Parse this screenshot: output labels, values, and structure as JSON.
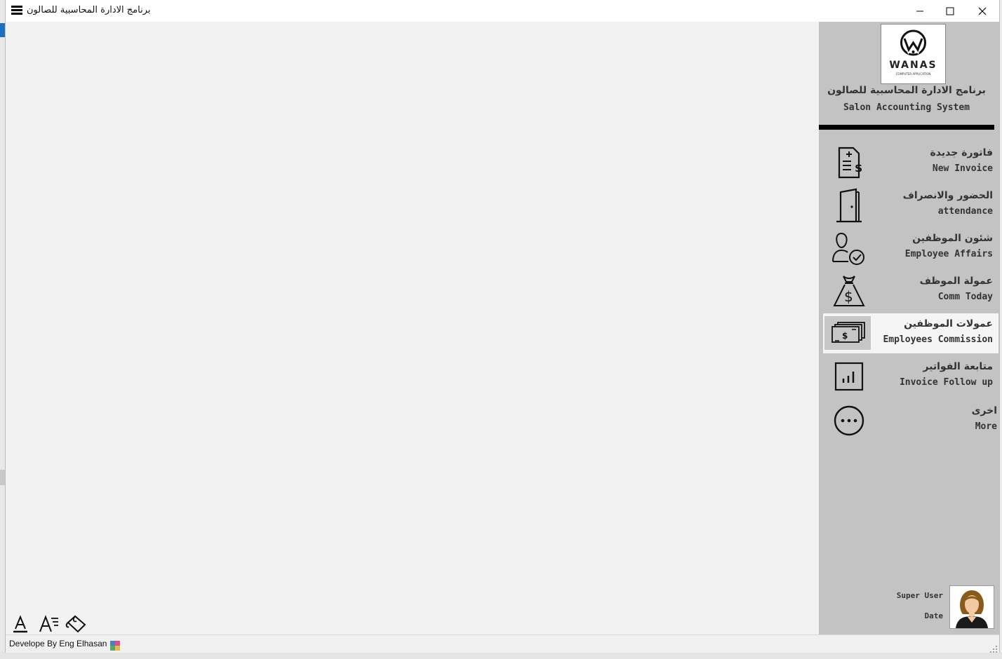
{
  "window": {
    "title": "برنامج الادارة المحاسبية للصالون"
  },
  "sidebar": {
    "logo": {
      "brand": "WANAS",
      "tagline": "COMPUTER APPLICATION"
    },
    "app_title_ar": "برنامج الادارة المحاسبية للصالون",
    "app_title_en": "Salon Accounting System",
    "items": [
      {
        "label_ar": "فاتورة جديدة",
        "label_en": "New Invoice",
        "icon": "invoice-icon"
      },
      {
        "label_ar": "الحضور والانصراف",
        "label_en": "attendance",
        "icon": "door-icon"
      },
      {
        "label_ar": "شئون الموظفين",
        "label_en": "Employee Affairs",
        "icon": "user-check-icon"
      },
      {
        "label_ar": "عمولة الموظف",
        "label_en": "Comm Today",
        "icon": "money-bag-icon"
      },
      {
        "label_ar": "عمولات الموظفين",
        "label_en": "Employees Commission",
        "icon": "cash-stack-icon",
        "active": true
      },
      {
        "label_ar": "متابعة الفواتير",
        "label_en": "Invoice Follow up",
        "icon": "bar-chart-icon"
      },
      {
        "label_ar": "اخرى",
        "label_en": "More",
        "icon": "more-icon"
      }
    ],
    "user": {
      "name": "Super User",
      "date_label": "Date"
    }
  },
  "statusbar": {
    "developer": "Develope By Eng Elhasan"
  },
  "colors": {
    "sidebar_bg": "#c3c3c3",
    "main_bg": "#f2f2f2",
    "active_item_bg": "#f5f5f5",
    "text": "#333333"
  }
}
